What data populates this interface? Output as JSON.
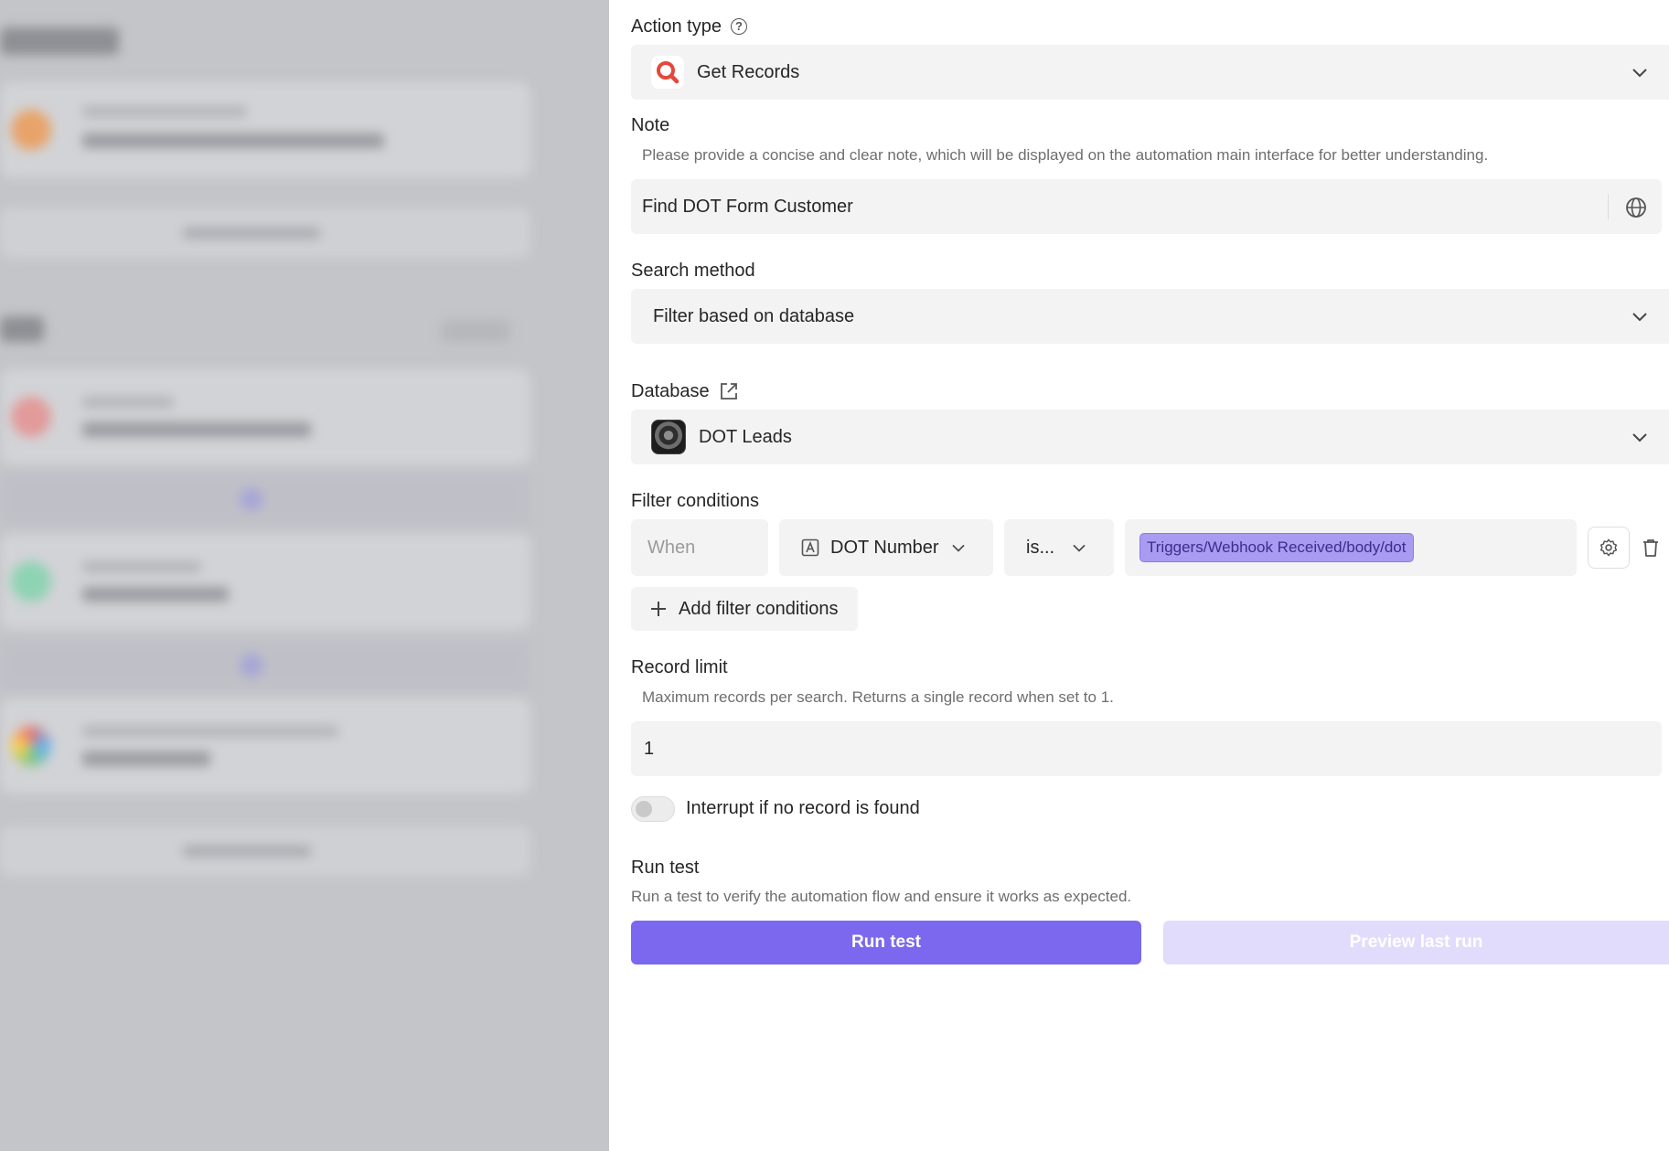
{
  "action_type": {
    "label": "Action type",
    "value": "Get Records",
    "icon": "search-icon"
  },
  "note": {
    "label": "Note",
    "hint": "Please provide a concise and clear note, which will be displayed on the automation main interface for better understanding.",
    "value": "Find DOT Form Customer"
  },
  "search_method": {
    "label": "Search method",
    "value": "Filter based on database"
  },
  "database": {
    "label": "Database",
    "value": "DOT Leads"
  },
  "filter_conditions": {
    "label": "Filter conditions",
    "when": "When",
    "field": "DOT Number",
    "operator": "is...",
    "value_token": "Triggers/Webhook Received/body/dot",
    "add_label": "Add filter conditions"
  },
  "record_limit": {
    "label": "Record limit",
    "hint": "Maximum records per search. Returns a single record when set to 1.",
    "value": "1"
  },
  "interrupt": {
    "label": "Interrupt if no record is found",
    "enabled": false
  },
  "run_test": {
    "label": "Run test",
    "hint": "Run a test to verify the automation flow and ensure it works as expected.",
    "run_button": "Run test",
    "preview_button": "Preview last run"
  },
  "colors": {
    "accent": "#7b68ee",
    "accent_disabled": "#e2dcfc",
    "token_bg": "#a99bf1",
    "field_bg": "#f3f3f3"
  }
}
